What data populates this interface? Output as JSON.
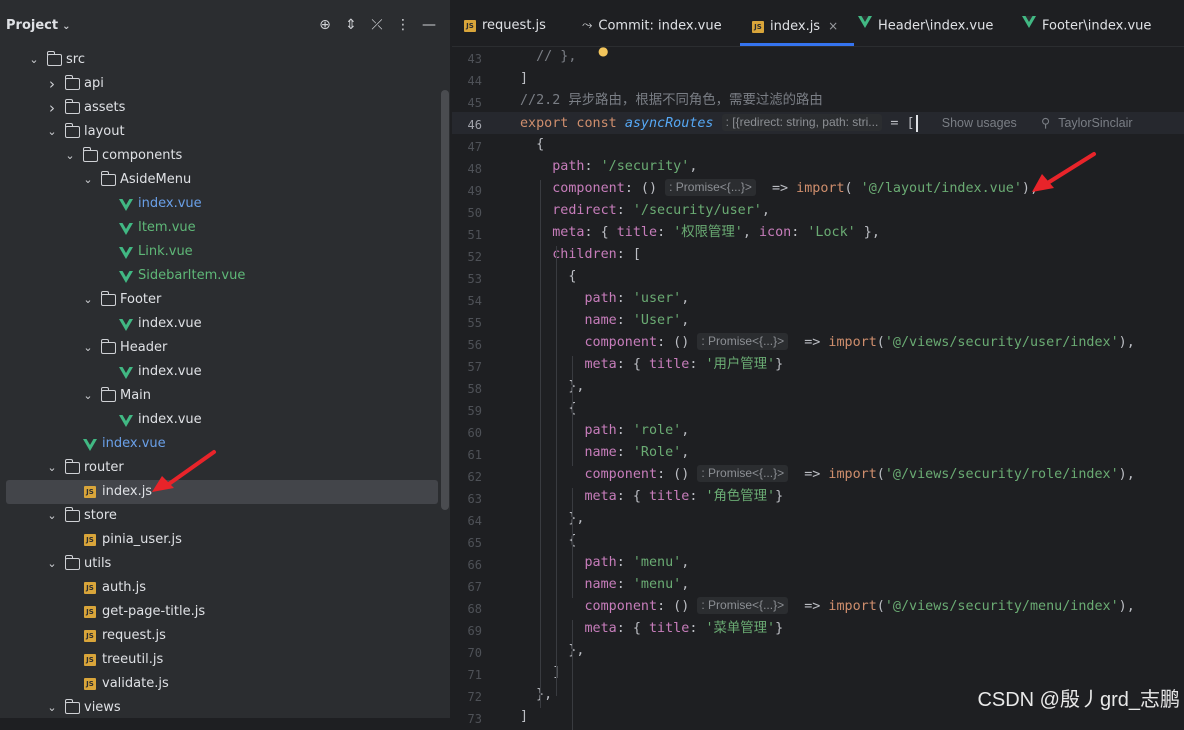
{
  "sidebar": {
    "title": "Project",
    "toolbar_icons": [
      "crosshair-icon",
      "expand-icon",
      "collapse-icon",
      "more-icon",
      "minimize-icon"
    ],
    "tree": [
      {
        "label": "src",
        "type": "folder",
        "depth": 1,
        "expanded": true
      },
      {
        "label": "api",
        "type": "folder",
        "depth": 2,
        "expanded": false
      },
      {
        "label": "assets",
        "type": "folder",
        "depth": 2,
        "expanded": false
      },
      {
        "label": "layout",
        "type": "folder",
        "depth": 2,
        "expanded": true
      },
      {
        "label": "components",
        "type": "folder",
        "depth": 3,
        "expanded": true
      },
      {
        "label": "AsideMenu",
        "type": "folder",
        "depth": 4,
        "expanded": true
      },
      {
        "label": "index.vue",
        "type": "vue",
        "depth": 5,
        "status": "modified"
      },
      {
        "label": "Item.vue",
        "type": "vue",
        "depth": 5,
        "status": "new"
      },
      {
        "label": "Link.vue",
        "type": "vue",
        "depth": 5,
        "status": "new"
      },
      {
        "label": "SidebarItem.vue",
        "type": "vue",
        "depth": 5,
        "status": "new"
      },
      {
        "label": "Footer",
        "type": "folder",
        "depth": 4,
        "expanded": true
      },
      {
        "label": "index.vue",
        "type": "vue",
        "depth": 5,
        "status": "none"
      },
      {
        "label": "Header",
        "type": "folder",
        "depth": 4,
        "expanded": true
      },
      {
        "label": "index.vue",
        "type": "vue",
        "depth": 5,
        "status": "none"
      },
      {
        "label": "Main",
        "type": "folder",
        "depth": 4,
        "expanded": true
      },
      {
        "label": "index.vue",
        "type": "vue",
        "depth": 5,
        "status": "none"
      },
      {
        "label": "index.vue",
        "type": "vue",
        "depth": 3,
        "status": "modified"
      },
      {
        "label": "router",
        "type": "folder",
        "depth": 2,
        "expanded": true
      },
      {
        "label": "index.js",
        "type": "js",
        "depth": 3,
        "status": "none",
        "selected": true
      },
      {
        "label": "store",
        "type": "folder",
        "depth": 2,
        "expanded": true
      },
      {
        "label": "pinia_user.js",
        "type": "js",
        "depth": 3,
        "status": "none"
      },
      {
        "label": "utils",
        "type": "folder",
        "depth": 2,
        "expanded": true
      },
      {
        "label": "auth.js",
        "type": "js",
        "depth": 3,
        "status": "none"
      },
      {
        "label": "get-page-title.js",
        "type": "js",
        "depth": 3,
        "status": "none"
      },
      {
        "label": "request.js",
        "type": "js",
        "depth": 3,
        "status": "none"
      },
      {
        "label": "treeutil.js",
        "type": "js",
        "depth": 3,
        "status": "none"
      },
      {
        "label": "validate.js",
        "type": "js",
        "depth": 3,
        "status": "none"
      },
      {
        "label": "views",
        "type": "folder",
        "depth": 2,
        "expanded": true
      }
    ]
  },
  "tabs": [
    {
      "label": "request.js",
      "icon": "js-file-icon",
      "active": false
    },
    {
      "label": "Commit: index.vue",
      "icon": "commit-icon",
      "active": false
    },
    {
      "label": "index.js",
      "icon": "js-file-icon",
      "active": true,
      "close": "×"
    },
    {
      "label": "Header\\index.vue",
      "icon": "vue-file-icon",
      "active": false
    },
    {
      "label": "Footer\\index.vue",
      "icon": "vue-file-icon",
      "active": false
    }
  ],
  "editor": {
    "current_line": 46,
    "hints": {
      "routes_type": ": [{redirect: string, path: stri...",
      "promise": ": Promise<{...}>",
      "show_usages": "Show usages",
      "author": "TaylorSinclair"
    },
    "lines": [
      {
        "n": 43,
        "text": "  // },"
      },
      {
        "n": 44,
        "text": "]"
      },
      {
        "n": 45,
        "text": "//2.2 异步路由，根据不同角色，需要过滤的路由"
      },
      {
        "n": 46,
        "text": "export const asyncRoutes = ["
      },
      {
        "n": 47,
        "text": "  {"
      },
      {
        "n": 48,
        "text": "    path: '/security',"
      },
      {
        "n": 49,
        "text": "    component: () => import( '@/layout/index.vue'),"
      },
      {
        "n": 50,
        "text": "    redirect: '/security/user',"
      },
      {
        "n": 51,
        "text": "    meta: { title: '权限管理', icon: 'Lock' },"
      },
      {
        "n": 52,
        "text": "    children: ["
      },
      {
        "n": 53,
        "text": "      {"
      },
      {
        "n": 54,
        "text": "        path: 'user',"
      },
      {
        "n": 55,
        "text": "        name: 'User',"
      },
      {
        "n": 56,
        "text": "        component: () => import('@/views/security/user/index'),"
      },
      {
        "n": 57,
        "text": "        meta: { title: '用户管理'}"
      },
      {
        "n": 58,
        "text": "      },"
      },
      {
        "n": 59,
        "text": "      {"
      },
      {
        "n": 60,
        "text": "        path: 'role',"
      },
      {
        "n": 61,
        "text": "        name: 'Role',"
      },
      {
        "n": 62,
        "text": "        component: () => import('@/views/security/role/index'),"
      },
      {
        "n": 63,
        "text": "        meta: { title: '角色管理'}"
      },
      {
        "n": 64,
        "text": "      },"
      },
      {
        "n": 65,
        "text": "      {"
      },
      {
        "n": 66,
        "text": "        path: 'menu',"
      },
      {
        "n": 67,
        "text": "        name: 'menu',"
      },
      {
        "n": 68,
        "text": "        component: () => import('@/views/security/menu/index'),"
      },
      {
        "n": 69,
        "text": "        meta: { title: '菜单管理'}"
      },
      {
        "n": 70,
        "text": "      },"
      },
      {
        "n": 71,
        "text": "    ]"
      },
      {
        "n": 72,
        "text": "  },"
      },
      {
        "n": 73,
        "text": "]"
      }
    ]
  },
  "watermark": "CSDN @殷丿grd_志鹏",
  "colors": {
    "accent": "#3574f0",
    "keyword": "#cf8e6d",
    "property": "#c77dbb",
    "string": "#6aab73",
    "function": "#56a8f5",
    "vue": "#41b883",
    "arrow": "#e8242a"
  }
}
